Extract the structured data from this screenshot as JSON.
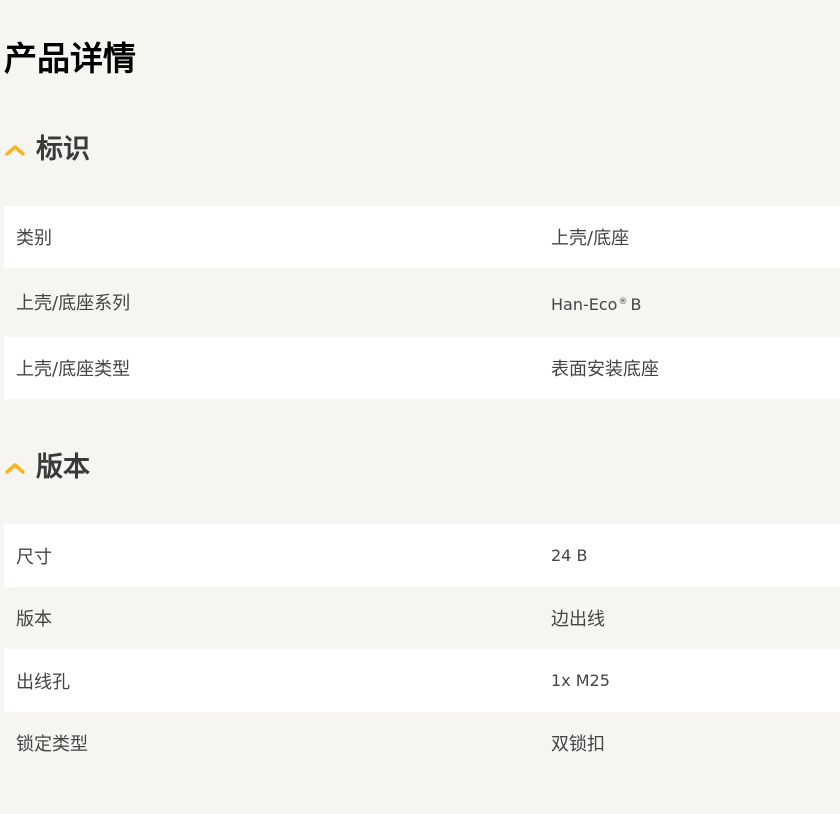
{
  "page": {
    "title": "产品详情"
  },
  "sections": [
    {
      "title": "标识",
      "rows": [
        {
          "label": "类别",
          "value": "上壳/底座"
        },
        {
          "label": "上壳/底座系列",
          "value_prefix": "Han-Eco",
          "value_mark": "®",
          "value_suffix": "B"
        },
        {
          "label": "上壳/底座类型",
          "value": "表面安装底座"
        }
      ]
    },
    {
      "title": "版本",
      "rows": [
        {
          "label": "尺寸",
          "value": "24 B"
        },
        {
          "label": "版本",
          "value": "边出线"
        },
        {
          "label": "出线孔",
          "value": "1x M25"
        },
        {
          "label": "锁定类型",
          "value": "双锁扣"
        }
      ]
    }
  ],
  "colors": {
    "accent": "#f5b71d",
    "background": "#f6f5f2",
    "row_white": "#ffffff",
    "text": "#444444"
  }
}
